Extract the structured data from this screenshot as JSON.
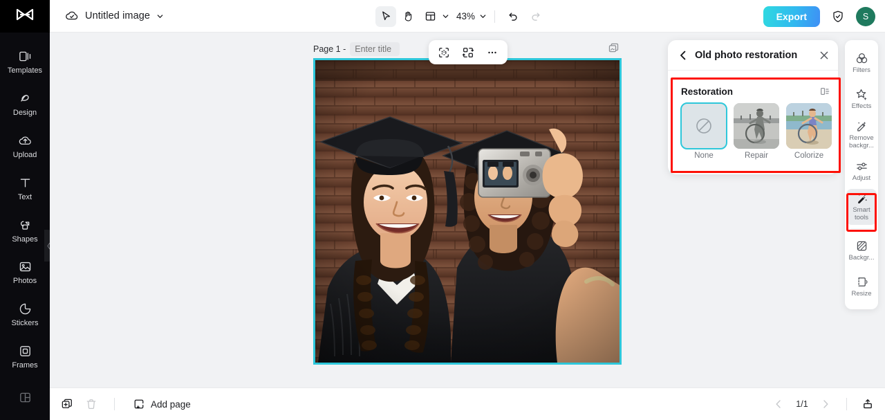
{
  "app": {
    "logo_icon": "capcut-logo-icon",
    "doc_title": "Untitled image",
    "cloud_icon": "cloud-sync-icon",
    "title_caret_icon": "chevron-down-icon"
  },
  "toolbar": {
    "select_icon": "cursor-arrow-icon",
    "hand_icon": "hand-pan-icon",
    "layout_icon": "layout-grid-icon",
    "layout_caret_icon": "chevron-down-icon",
    "zoom_value": "43%",
    "zoom_caret_icon": "chevron-down-icon",
    "undo_icon": "undo-arrow-icon",
    "redo_icon": "redo-arrow-icon",
    "export_label": "Export",
    "shield_icon": "shield-check-icon",
    "avatar_initial": "S"
  },
  "sidebar": {
    "items": [
      {
        "label": "Templates",
        "icon": "templates-icon"
      },
      {
        "label": "Design",
        "icon": "design-icon"
      },
      {
        "label": "Upload",
        "icon": "upload-cloud-icon"
      },
      {
        "label": "Text",
        "icon": "text-icon"
      },
      {
        "label": "Shapes",
        "icon": "shapes-icon"
      },
      {
        "label": "Photos",
        "icon": "photos-icon"
      },
      {
        "label": "Stickers",
        "icon": "stickers-icon"
      },
      {
        "label": "Frames",
        "icon": "frames-icon"
      },
      {
        "label": "",
        "icon": "layout-panels-icon"
      }
    ],
    "collapse_icon": "chevron-left-icon"
  },
  "canvas": {
    "page_number_label": "Page 1 -",
    "page_title_value": "",
    "page_title_placeholder": "Enter title",
    "duplicate_page_icon": "duplicate-page-icon",
    "selection_color": "#2ec7da",
    "float_toolbar": {
      "cutout_icon": "smart-cutout-icon",
      "replace_icon": "replace-image-icon",
      "more_icon": "more-options-icon"
    },
    "image_alt": "Two graduates in caps and gowns taking a selfie with a compact camera in front of a brick wall"
  },
  "right_panel": {
    "back_icon": "chevron-left-icon",
    "title": "Old photo restoration",
    "close_icon": "close-icon",
    "restoration": {
      "section_label": "Restoration",
      "compare_icon": "before-after-compare-icon",
      "highlight_color": "#fd1107",
      "selected": "None",
      "options": [
        {
          "label": "None",
          "icon": "no-effect-icon",
          "selected": true
        },
        {
          "label": "Repair",
          "icon": "repair-thumbnail",
          "selected": false
        },
        {
          "label": "Colorize",
          "icon": "colorize-thumbnail",
          "selected": false
        }
      ]
    }
  },
  "right_rail": {
    "highlight_color": "#fd1107",
    "items": [
      {
        "label": "Filters",
        "icon": "filters-icon",
        "active": false
      },
      {
        "label": "Effects",
        "icon": "effects-icon",
        "active": false
      },
      {
        "label": "Remove backgr...",
        "icon": "remove-background-icon",
        "active": false
      },
      {
        "label": "Adjust",
        "icon": "adjust-sliders-icon",
        "active": false
      },
      {
        "label": "Smart tools",
        "icon": "smart-tools-icon",
        "active": true
      },
      {
        "label": "Backgr...",
        "icon": "background-icon",
        "active": false
      },
      {
        "label": "Resize",
        "icon": "resize-icon",
        "active": false
      }
    ]
  },
  "bottom_bar": {
    "duplicate_icon": "duplicate-icon",
    "delete_icon": "trash-icon",
    "add_page_icon": "add-page-icon",
    "add_page_label": "Add page",
    "prev_icon": "chevron-left-icon",
    "page_indicator": "1/1",
    "next_icon": "chevron-right-icon",
    "present_icon": "present-icon"
  }
}
